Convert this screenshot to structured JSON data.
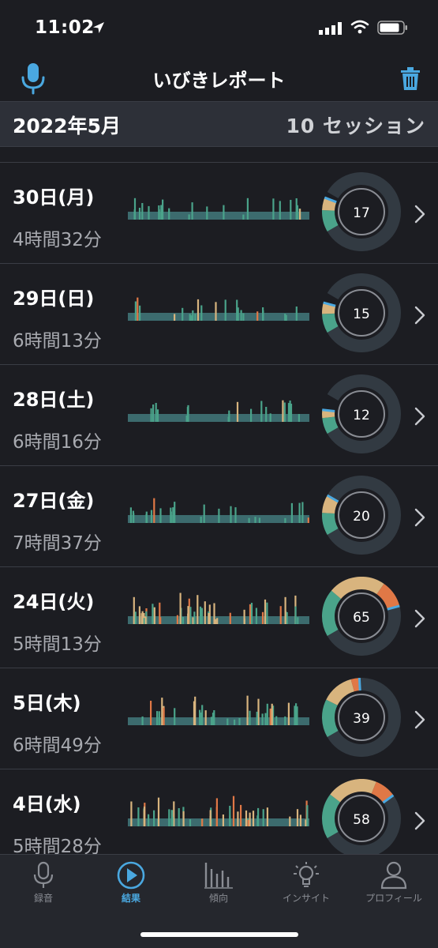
{
  "status_bar": {
    "time": "11:02"
  },
  "nav": {
    "title": "いびきレポート",
    "mic_icon": "microphone-icon",
    "trash_icon": "trash-icon"
  },
  "month": {
    "title": "2022年5月",
    "session_count": "10 セッション"
  },
  "colors": {
    "accent": "#4aa8e0",
    "quiet": "#4aa38a",
    "light": "#d8b47e",
    "loud": "#e07846",
    "baseline": "#3c6b6e",
    "gauge_track": "#323a42"
  },
  "sessions": [
    {
      "date": "30日(月)",
      "duration": "4時間32分",
      "score": "17",
      "level": 0.17,
      "split": [
        0.55,
        0.32,
        0.0
      ]
    },
    {
      "date": "29日(日)",
      "duration": "6時間13分",
      "score": "15",
      "level": 0.15,
      "split": [
        0.6,
        0.35,
        0.0
      ]
    },
    {
      "date": "28日(土)",
      "duration": "6時間16分",
      "score": "12",
      "level": 0.12,
      "split": [
        0.6,
        0.3,
        0.0
      ]
    },
    {
      "date": "27日(金)",
      "duration": "7時間37分",
      "score": "20",
      "level": 0.2,
      "split": [
        0.5,
        0.4,
        0.0
      ]
    },
    {
      "date": "24日(火)",
      "duration": "5時間13分",
      "score": "65",
      "level": 0.65,
      "split": [
        0.35,
        0.42,
        0.2
      ]
    },
    {
      "date": "5日(木)",
      "duration": "6時間49分",
      "score": "39",
      "level": 0.39,
      "split": [
        0.45,
        0.38,
        0.1
      ]
    },
    {
      "date": "4日(水)",
      "duration": "5時間28分",
      "score": "58",
      "level": 0.58,
      "split": [
        0.38,
        0.42,
        0.18
      ]
    }
  ],
  "tabs": [
    {
      "label": "録音",
      "icon": "microphone-icon",
      "active": false
    },
    {
      "label": "結果",
      "icon": "play-circle-icon",
      "active": true
    },
    {
      "label": "傾向",
      "icon": "bar-chart-icon",
      "active": false
    },
    {
      "label": "インサイト",
      "icon": "lightbulb-icon",
      "active": false
    },
    {
      "label": "プロフィール",
      "icon": "person-icon",
      "active": false
    }
  ]
}
